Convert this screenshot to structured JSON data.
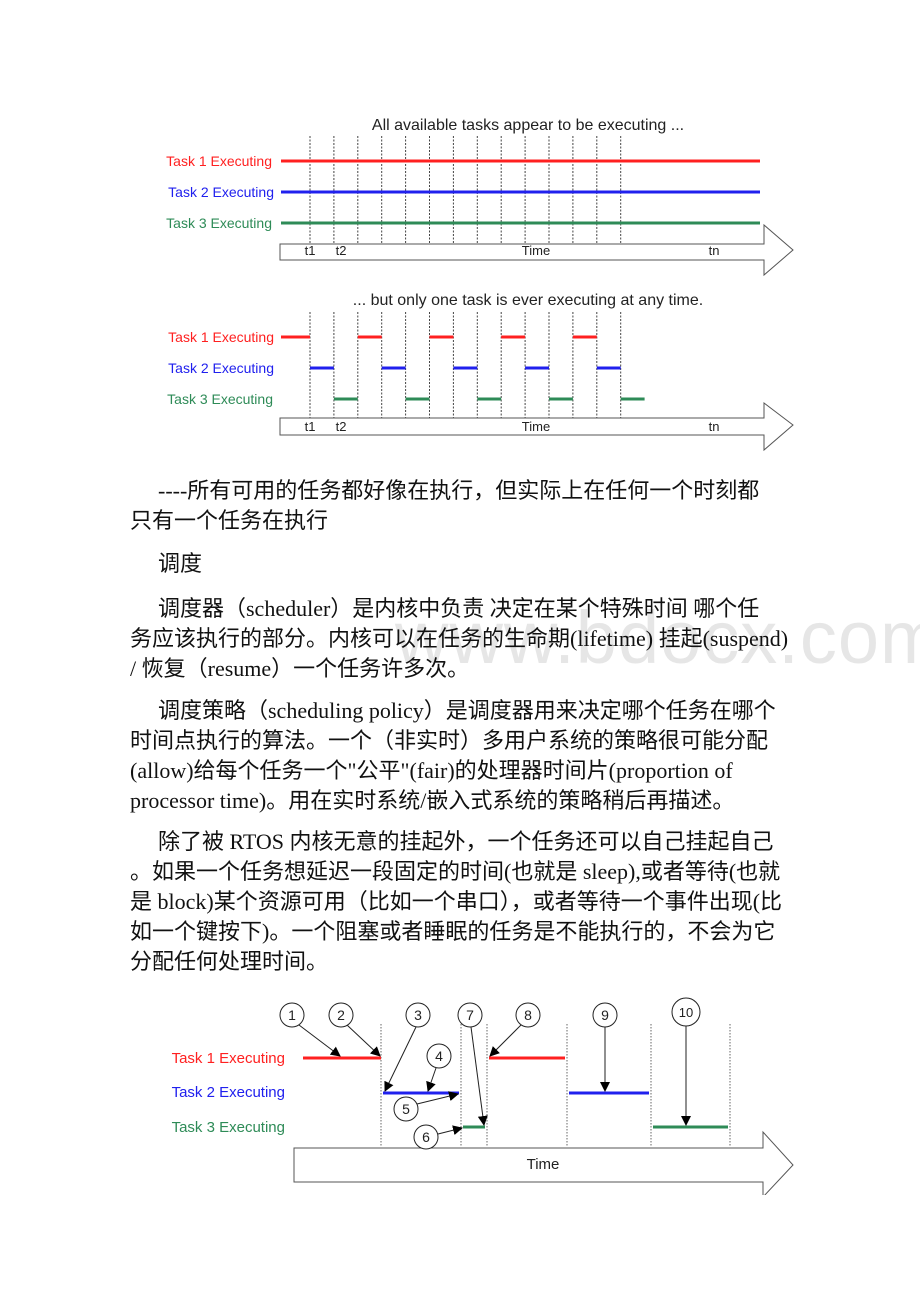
{
  "figure1": {
    "title": "All available tasks appear to be executing ...",
    "tasks": [
      {
        "label": "Task 1 Executing",
        "color": "#ff2020"
      },
      {
        "label": "Task 2 Executing",
        "color": "#2020ee"
      },
      {
        "label": "Task 3 Executing",
        "color": "#2e8b57"
      }
    ],
    "axis_label": "Time",
    "tick_labels": {
      "t1": "t1",
      "t2": "t2",
      "tn": "tn"
    }
  },
  "figure2": {
    "title": "... but only one task is ever executing at any time.",
    "tasks": [
      {
        "label": "Task 1 Executing",
        "color": "#ff2020"
      },
      {
        "label": "Task 2 Executing",
        "color": "#2020ee"
      },
      {
        "label": "Task 3 Executing",
        "color": "#2e8b57"
      }
    ],
    "axis_label": "Time",
    "tick_labels": {
      "t1": "t1",
      "t2": "t2",
      "tn": "tn"
    },
    "schedule": [
      1,
      2,
      3,
      1,
      2,
      3,
      1,
      2,
      3,
      1,
      2,
      3,
      1,
      2,
      3
    ]
  },
  "paragraphs": {
    "p1": [
      "----所有可用的任务都好像在执行，但实际上在任何一个时刻都",
      "只有一个任务在执行"
    ],
    "heading": "调度",
    "p2": [
      "调度器（scheduler）是内核中负责 决定在某个特殊时间 哪个任",
      "务应该执行的部分。内核可以在任务的生命期(lifetime) 挂起(suspend)",
      "/ 恢复（resume）一个任务许多次。"
    ],
    "p3": [
      "调度策略（scheduling policy）是调度器用来决定哪个任务在哪个",
      "时间点执行的算法。一个（非实时）多用户系统的策略很可能分配",
      "(allow)给每个任务一个\"公平\"(fair)的处理器时间片(proportion of",
      "processor time)。用在实时系统/嵌入式系统的策略稍后再描述。"
    ],
    "p4": [
      "除了被 RTOS 内核无意的挂起外，一个任务还可以自己挂起自己",
      "。如果一个任务想延迟一段固定的时间(也就是 sleep),或者等待(也就",
      "是 block)某个资源可用（比如一个串口），或者等待一个事件出现(比",
      "如一个键按下)。一个阻塞或者睡眠的任务是不能执行的，不会为它",
      "分配任何处理时间。"
    ]
  },
  "figure3": {
    "tasks": [
      {
        "label": "Task 1 Executing",
        "color": "#ff2020"
      },
      {
        "label": "Task 2 Executing",
        "color": "#2020ee"
      },
      {
        "label": "Task 3 Executing",
        "color": "#2e8b57"
      }
    ],
    "axis_label": "Time",
    "callouts": [
      "1",
      "2",
      "3",
      "4",
      "5",
      "6",
      "7",
      "8",
      "9",
      "10"
    ]
  },
  "watermark": "www.bdocx.com"
}
